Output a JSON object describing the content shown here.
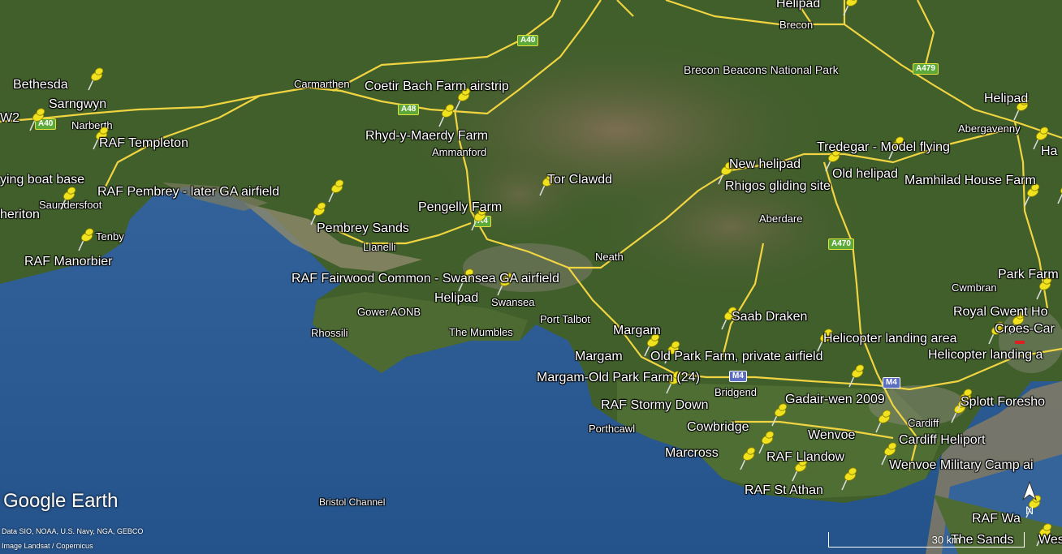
{
  "app": {
    "logo": "Google Earth",
    "credits": [
      "Data SIO, NOAA, U.S. Navy, NGA, GEBCO",
      "Image Landsat / Copernicus"
    ],
    "scale_label": "30 km"
  },
  "colors": {
    "land": "#3f5f2a",
    "sea": "#2f5d93",
    "road": "#f1d546",
    "pin": "#f0e21e"
  },
  "places": [
    {
      "name": "Brecon"
    },
    {
      "name": "Brecon Beacons National Park"
    },
    {
      "name": "Carmarthen"
    },
    {
      "name": "Narberth"
    },
    {
      "name": "Ammanford"
    },
    {
      "name": "Abergavenny"
    },
    {
      "name": "Aberdare"
    },
    {
      "name": "Saundersfoot"
    },
    {
      "name": "Tenby"
    },
    {
      "name": "Llanelli"
    },
    {
      "name": "Neath"
    },
    {
      "name": "Cwmbran"
    },
    {
      "name": "Gower AONB"
    },
    {
      "name": "Swansea"
    },
    {
      "name": "Port Talbot"
    },
    {
      "name": "Rhossili"
    },
    {
      "name": "The Mumbles"
    },
    {
      "name": "Bridgend"
    },
    {
      "name": "Porthcawl"
    },
    {
      "name": "Cardiff"
    },
    {
      "name": "Bristol Channel"
    }
  ],
  "roads": [
    "A40",
    "A40",
    "A479",
    "A48",
    "A470",
    "M4",
    "M4",
    "M4",
    "A4"
  ],
  "placemarks": [
    {
      "label": "Helipad"
    },
    {
      "label": "Bethesda"
    },
    {
      "label": "Sarngwyn"
    },
    {
      "label": "W2"
    },
    {
      "label": "Coetir Bach Farm airstrip"
    },
    {
      "label": "RAF Templeton"
    },
    {
      "label": "Rhyd-y-Maerdy Farm"
    },
    {
      "label": "Helipad"
    },
    {
      "label": "Ha"
    },
    {
      "label": "ying boat base"
    },
    {
      "label": "Tredegar - Model flying"
    },
    {
      "label": "New helipad"
    },
    {
      "label": "Old helipad"
    },
    {
      "label": "Tor Clawdd"
    },
    {
      "label": "Mamhilad House Farm"
    },
    {
      "label": "RAF Pembrey - later GA airfield"
    },
    {
      "label": "Rhigos gliding site"
    },
    {
      "label": "heriton"
    },
    {
      "label": "Pengelly Farm"
    },
    {
      "label": "Pembrey Sands"
    },
    {
      "label": "RAF Manorbier"
    },
    {
      "label": "Park Farm"
    },
    {
      "label": "RAF Fairwood Common - Swansea GA airfield"
    },
    {
      "label": "Helipad"
    },
    {
      "label": "Royal Gwent Ho"
    },
    {
      "label": "Saab Draken"
    },
    {
      "label": "Croes-Car"
    },
    {
      "label": "Margam"
    },
    {
      "label": "Helicopter landing area"
    },
    {
      "label": "Helicopter landing a"
    },
    {
      "label": "Margam"
    },
    {
      "label": "Old Park Farm, private airfield"
    },
    {
      "label": "Margam-Old Park Farm (24)"
    },
    {
      "label": "Gadair-wen 2009"
    },
    {
      "label": "Splott Foresho"
    },
    {
      "label": "RAF Stormy Down"
    },
    {
      "label": "Cowbridge"
    },
    {
      "label": "Wenvoe"
    },
    {
      "label": "Cardiff Heliport"
    },
    {
      "label": "Marcross"
    },
    {
      "label": "RAF Llandow"
    },
    {
      "label": "Wenvoe Military Camp ai"
    },
    {
      "label": "RAF St Athan"
    },
    {
      "label": "RAF Wa"
    },
    {
      "label": "The Sands"
    },
    {
      "label": "Wes"
    }
  ]
}
